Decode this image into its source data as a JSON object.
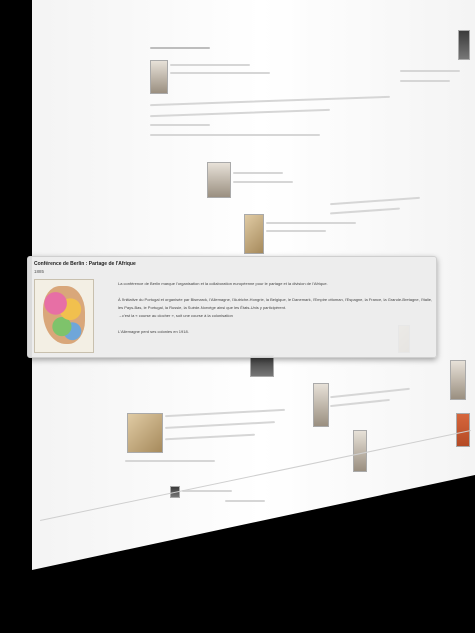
{
  "event": {
    "title": "Conférence de Berlin : Partage de l'Afrique",
    "date": "1885",
    "paragraph1": "La conférence de Berlin marque l'organisation et la collaboration européenne pour le partage et la division de l'Afrique.",
    "paragraph2a": "À l'initiative du Portugal et organisée par Bismarck, l'Allemagne, l'Autriche-Hongrie, la Belgique, le Danemark, l'Empire ottoman, l'Espagne, la France, la Grande-Bretagne, l'Italie,",
    "paragraph2b": "les Pays-Bas, le Portugal, la Russie, la Suède-Norvège ainsi que les États-Unis y participèrent.",
    "arrow_note": "c'est la « course au clocher », soit une course à la colonisation",
    "paragraph3": "L'Allemagne perd ses colonies en 1918.",
    "image_icon": "africa-map-icon"
  },
  "colors": {
    "background": "#000000",
    "plane": "#ffffff",
    "card": "#ececec"
  }
}
